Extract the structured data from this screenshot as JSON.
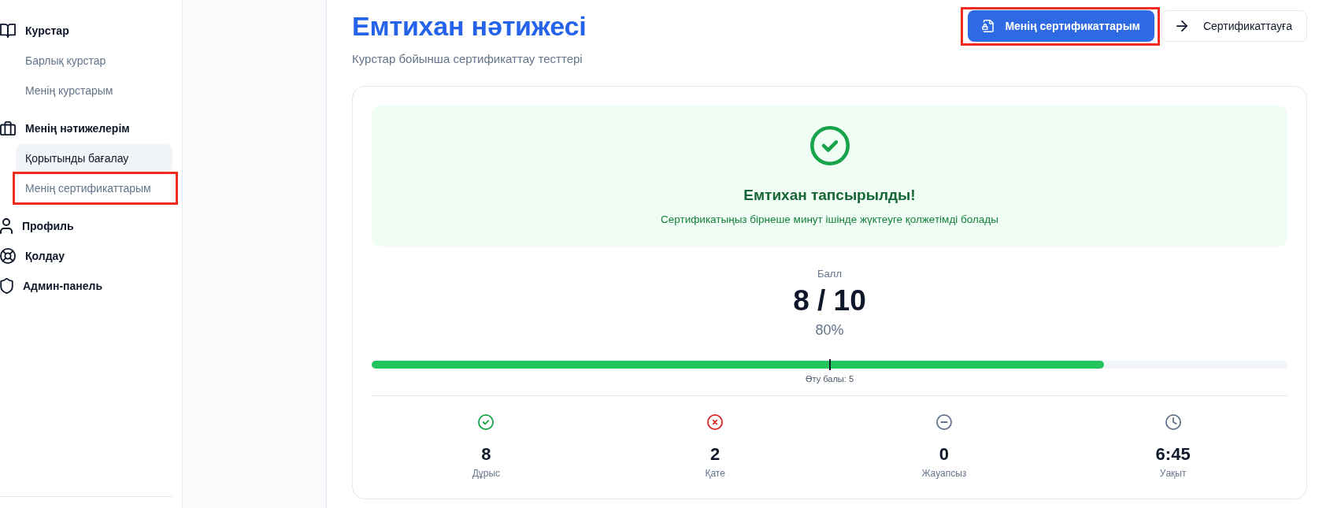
{
  "sidebar": {
    "items": [
      {
        "label": "Курстар",
        "selected": false,
        "highlighted": false,
        "children": [
          {
            "label": "Барлық курстар",
            "selected": false,
            "highlighted": false
          },
          {
            "label": "Менің курстарым",
            "selected": false,
            "highlighted": false
          }
        ]
      },
      {
        "label": "Менің нәтижелерім",
        "selected": false,
        "highlighted": false,
        "children": [
          {
            "label": "Қорытынды бағалау",
            "selected": true,
            "highlighted": false
          },
          {
            "label": "Менің сертификаттарым",
            "selected": false,
            "highlighted": true
          }
        ]
      },
      {
        "label": "Профиль",
        "selected": false,
        "highlighted": false
      },
      {
        "label": "Қолдау",
        "selected": false,
        "highlighted": false
      },
      {
        "label": "Админ-панель",
        "selected": false,
        "highlighted": false
      }
    ]
  },
  "header": {
    "title": "Емтихан нәтижесі",
    "subtitle": "Курстар бойынша сертификаттау тесттері",
    "buttons": [
      {
        "label": "Менің сертификаттарым",
        "kind": "primary",
        "highlighted": true
      },
      {
        "label": "Сертификаттауға",
        "kind": "secondary",
        "highlighted": false
      }
    ]
  },
  "result": {
    "banner": {
      "passed": true,
      "title": "Емтихан тапсырылды!",
      "message": "Сертификатыңыз бірнеше минут ішінде жүктеуге қолжетімді болады"
    },
    "score": {
      "label": "Балл",
      "value": "8 / 10",
      "percent": "80%",
      "level": 0.8,
      "pass_marker": {
        "level": 0.5,
        "label": "Өту балы: 5"
      }
    },
    "stats": [
      {
        "kind": "correct",
        "value": "8",
        "label": "Дұрыс"
      },
      {
        "kind": "wrong",
        "value": "2",
        "label": "Қате"
      },
      {
        "kind": "unanswered",
        "value": "0",
        "label": "Жауапсыз"
      },
      {
        "kind": "time",
        "value": "6:45",
        "label": "Уақыт"
      }
    ]
  }
}
